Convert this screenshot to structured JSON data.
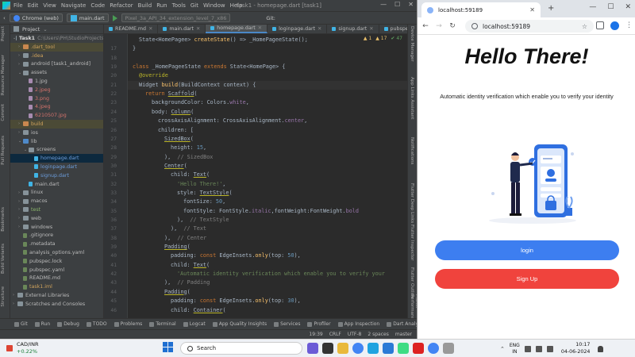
{
  "ide": {
    "menu": [
      "File",
      "Edit",
      "View",
      "Navigate",
      "Code",
      "Refactor",
      "Build",
      "Run",
      "Tools",
      "Git",
      "Window",
      "Help"
    ],
    "title": "task1 - homepage.dart [task1]",
    "toolbar": {
      "device": "Chrome (web)",
      "run_config": "main.dart",
      "device_path": "Pixel_3a_API_34_extension_level_7_x86",
      "git_label": "Git:"
    },
    "project_panel": {
      "header": "Project",
      "root_label": "Task1",
      "root_path": "C:\\Users\\PH\\StudioProjects",
      "items": [
        {
          "label": ".dart_tool",
          "indent": 1,
          "arrow": "›",
          "icon": "folder-orange",
          "color": "orange",
          "hl": true
        },
        {
          "label": ".idea",
          "indent": 1,
          "arrow": "›",
          "icon": "folder",
          "color": "orange"
        },
        {
          "label": "android [task1_android]",
          "indent": 1,
          "arrow": "›",
          "icon": "folder",
          "color": "normal"
        },
        {
          "label": "assets",
          "indent": 1,
          "arrow": "⌄",
          "icon": "folder",
          "color": "normal"
        },
        {
          "label": "1.jpg",
          "indent": 2,
          "arrow": "",
          "icon": "img",
          "color": "normal"
        },
        {
          "label": "2.jpeg",
          "indent": 2,
          "arrow": "",
          "icon": "img",
          "color": "red"
        },
        {
          "label": "3.png",
          "indent": 2,
          "arrow": "",
          "icon": "img",
          "color": "red"
        },
        {
          "label": "4.jpeg",
          "indent": 2,
          "arrow": "",
          "icon": "img",
          "color": "red"
        },
        {
          "label": "6210507.jpg",
          "indent": 2,
          "arrow": "",
          "icon": "img",
          "color": "red"
        },
        {
          "label": "build",
          "indent": 1,
          "arrow": "›",
          "icon": "folder-orange",
          "color": "orange",
          "hl": true
        },
        {
          "label": "ios",
          "indent": 1,
          "arrow": "›",
          "icon": "folder",
          "color": "normal"
        },
        {
          "label": "lib",
          "indent": 1,
          "arrow": "⌄",
          "icon": "folder-blue",
          "color": "normal"
        },
        {
          "label": "screens",
          "indent": 2,
          "arrow": "⌄",
          "icon": "folder",
          "color": "normal"
        },
        {
          "label": "homepage.dart",
          "indent": 3,
          "arrow": "",
          "icon": "dart",
          "color": "blue",
          "sel": true
        },
        {
          "label": "loginpage.dart",
          "indent": 3,
          "arrow": "",
          "icon": "dart",
          "color": "blue"
        },
        {
          "label": "signup.dart",
          "indent": 3,
          "arrow": "",
          "icon": "dart",
          "color": "blue"
        },
        {
          "label": "main.dart",
          "indent": 2,
          "arrow": "",
          "icon": "dart",
          "color": "normal"
        },
        {
          "label": "linux",
          "indent": 1,
          "arrow": "›",
          "icon": "folder",
          "color": "normal"
        },
        {
          "label": "macos",
          "indent": 1,
          "arrow": "›",
          "icon": "folder",
          "color": "normal"
        },
        {
          "label": "test",
          "indent": 1,
          "arrow": "›",
          "icon": "folder",
          "color": "green"
        },
        {
          "label": "web",
          "indent": 1,
          "arrow": "›",
          "icon": "folder",
          "color": "normal"
        },
        {
          "label": "windows",
          "indent": 1,
          "arrow": "›",
          "icon": "folder",
          "color": "normal"
        },
        {
          "label": ".gitignore",
          "indent": 1,
          "arrow": "",
          "icon": "file",
          "color": "normal"
        },
        {
          "label": ".metadata",
          "indent": 1,
          "arrow": "",
          "icon": "file",
          "color": "normal"
        },
        {
          "label": "analysis_options.yaml",
          "indent": 1,
          "arrow": "",
          "icon": "file",
          "color": "normal"
        },
        {
          "label": "pubspec.lock",
          "indent": 1,
          "arrow": "",
          "icon": "file",
          "color": "normal"
        },
        {
          "label": "pubspec.yaml",
          "indent": 1,
          "arrow": "",
          "icon": "file",
          "color": "normal"
        },
        {
          "label": "README.md",
          "indent": 1,
          "arrow": "",
          "icon": "file",
          "color": "normal"
        },
        {
          "label": "task1.iml",
          "indent": 1,
          "arrow": "",
          "icon": "file",
          "color": "orange"
        },
        {
          "label": "External Libraries",
          "indent": 0,
          "arrow": "›",
          "icon": "folder",
          "color": "normal"
        },
        {
          "label": "Scratches and Consoles",
          "indent": 0,
          "arrow": "›",
          "icon": "folder",
          "color": "normal"
        }
      ]
    },
    "left_strip": [
      "Project",
      "Resource Manager",
      "Commit",
      "Pull Requests",
      "Bookmarks",
      "Build Variants",
      "Structure"
    ],
    "right_strip": [
      "Device Manager",
      "App Links Assistant",
      "Notifications",
      "Flutter Deep Links",
      "Flutter Inspector",
      "Flutter Outline",
      "Flutter Performance"
    ],
    "tabs": [
      {
        "label": "README.md",
        "active": false
      },
      {
        "label": "main.dart",
        "active": false
      },
      {
        "label": "homepage.dart",
        "active": true
      },
      {
        "label": "loginpage.dart",
        "active": false
      },
      {
        "label": "signup.dart",
        "active": false
      },
      {
        "label": "pubspecy",
        "active": false
      }
    ],
    "inspections": {
      "warnings": "▲ 1",
      "weak": "▲ 17",
      "typos": "✔ 47"
    },
    "code_lines": [
      {
        "n": "",
        "html": "State&lt;HomePagee&gt; <span class='fn'>createState</span>() =&gt; <span class='cls'>_HomePageeState</span>();",
        "indent": 1
      },
      {
        "n": "17",
        "html": "}",
        "indent": 0
      },
      {
        "n": "18",
        "html": "",
        "indent": 0
      },
      {
        "n": "19",
        "html": "<span class='kw'>class</span> _HomePageeState <span class='kw'>extends</span> State&lt;HomePage&gt; {",
        "indent": 0
      },
      {
        "n": "20",
        "html": "<span class='ann'>@override</span>",
        "indent": 1
      },
      {
        "n": "21",
        "html": "Widget <span class='fn'>build</span>(BuildContext context) {",
        "indent": 1,
        "hl": true
      },
      {
        "n": "22",
        "html": "<span class='kw'>return</span> <span class='widget-ul'>Scaffold</span>(",
        "indent": 2
      },
      {
        "n": "23",
        "html": "backgroundColor: Colors.<span class='prop'>white</span>,",
        "indent": 3
      },
      {
        "n": "24",
        "html": "body: <span class='widget-ul'>Column</span>(",
        "indent": 3
      },
      {
        "n": "25",
        "html": "crossAxisAlignment: CrossAxisAlignment.<span class='prop'>center</span>,",
        "indent": 4
      },
      {
        "n": "26",
        "html": "children: [",
        "indent": 4
      },
      {
        "n": "27",
        "html": "<span class='widget-ul'>SizedBox</span>(",
        "indent": 5
      },
      {
        "n": "28",
        "html": "height: <span class='num'>15</span>,",
        "indent": 6
      },
      {
        "n": "29",
        "html": "),  <span class='cmt'>// SizedBox</span>",
        "indent": 5
      },
      {
        "n": "30",
        "html": "<span class='widget-ul'>Center</span>(",
        "indent": 5
      },
      {
        "n": "31",
        "html": "child: <span class='widget-ul'>Text</span>(",
        "indent": 6
      },
      {
        "n": "32",
        "html": "<span class='str'>'Hello There!'</span>,",
        "indent": 7
      },
      {
        "n": "33",
        "html": "style: <span class='widget-ul'>TextStyle</span>(",
        "indent": 7
      },
      {
        "n": "34",
        "html": "fontSize: <span class='num'>50</span>,",
        "indent": 8
      },
      {
        "n": "35",
        "html": "fontStyle: FontStyle.<span class='prop'>italic</span>,fontWeight:FontWeight.<span class='prop'>bold</span>",
        "indent": 8
      },
      {
        "n": "36",
        "html": "),  <span class='cmt'>// TextStyle</span>",
        "indent": 7
      },
      {
        "n": "37",
        "html": "),  <span class='cmt'>// Text</span>",
        "indent": 6
      },
      {
        "n": "38",
        "html": "),  <span class='cmt'>// Center</span>",
        "indent": 5
      },
      {
        "n": "39",
        "html": "<span class='widget-ul'>Padding</span>(",
        "indent": 5
      },
      {
        "n": "40",
        "html": "padding: <span class='kw'>const</span> EdgeInsets.<span class='fn'>only</span>(top: <span class='num'>50</span>),",
        "indent": 6
      },
      {
        "n": "41",
        "html": "child: <span class='widget-ul'>Text</span>(",
        "indent": 6
      },
      {
        "n": "42",
        "html": "<span class='str'>'Automatic identity verification which enable you to verify your</span>",
        "indent": 7
      },
      {
        "n": "43",
        "html": "),  <span class='cmt'>// Padding</span>",
        "indent": 5
      },
      {
        "n": "44",
        "html": "<span class='widget-ul'>Padding</span>(",
        "indent": 5
      },
      {
        "n": "45",
        "html": "padding: <span class='kw'>const</span> EdgeInsets.<span class='fn'>only</span>(top: <span class='num'>30</span>),",
        "indent": 6
      },
      {
        "n": "46",
        "html": "child: <span class='widget-ul'>Container</span>(",
        "indent": 6
      }
    ],
    "bottom_tools": [
      "Git",
      "Run",
      "Debug",
      "TODO",
      "Problems",
      "Terminal",
      "Logcat",
      "App Quality Insights",
      "Services",
      "Profiler",
      "App Inspection",
      "Dart Analysis"
    ],
    "status": [
      "19:39",
      "CRLF",
      "UTF-8",
      "2 spaces",
      "master"
    ]
  },
  "browser": {
    "tab_title": "localhost:59189",
    "url": "localhost:59189",
    "page": {
      "heading": "Hello There!",
      "subtitle": "Automatic identity verification which enable you to verify your identity",
      "login_label": "login",
      "signup_label": "Sign Up"
    },
    "colors": {
      "login": "#3d7ef0",
      "signup": "#f0433d"
    }
  },
  "taskbar": {
    "widget_pair": "CAD/INR",
    "widget_change": "+0.22%",
    "search_placeholder": "Search",
    "lang_top": "ENG",
    "lang_bottom": "IN",
    "time": "10:17",
    "date": "04-06-2024"
  }
}
